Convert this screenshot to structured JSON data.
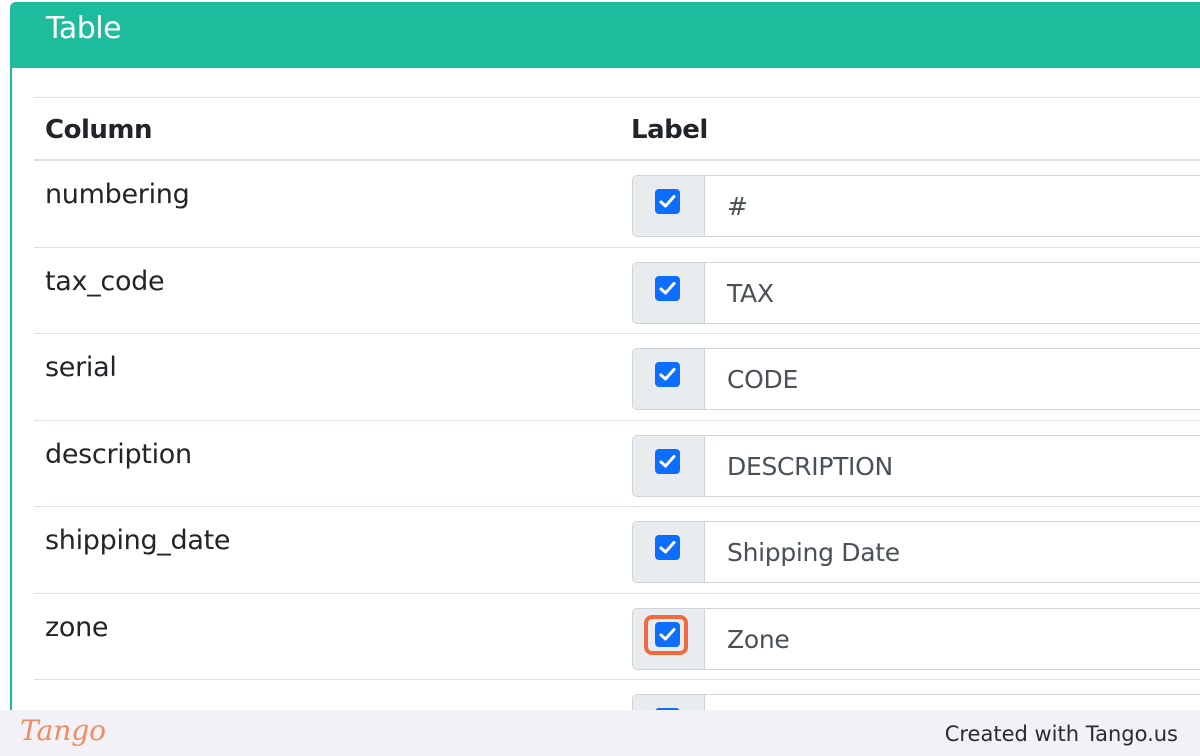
{
  "panel": {
    "title": "Table"
  },
  "table": {
    "headers": {
      "column": "Column",
      "label": "Label"
    },
    "rows": [
      {
        "column": "numbering",
        "label": "#",
        "checked": true
      },
      {
        "column": "tax_code",
        "label": "TAX",
        "checked": true
      },
      {
        "column": "serial",
        "label": "CODE",
        "checked": true
      },
      {
        "column": "description",
        "label": "DESCRIPTION",
        "checked": true
      },
      {
        "column": "shipping_date",
        "label": "Shipping Date",
        "checked": true
      },
      {
        "column": "zone",
        "label": "Zone",
        "checked": true,
        "highlighted": true
      },
      {
        "column": "",
        "label": "",
        "checked": true
      }
    ]
  },
  "footer": {
    "logo": "Tango",
    "credit": "Created with Tango.us"
  },
  "colors": {
    "header": "#1dbc9c",
    "checkbox": "#0d6efd",
    "highlight": "#f26a3b"
  }
}
